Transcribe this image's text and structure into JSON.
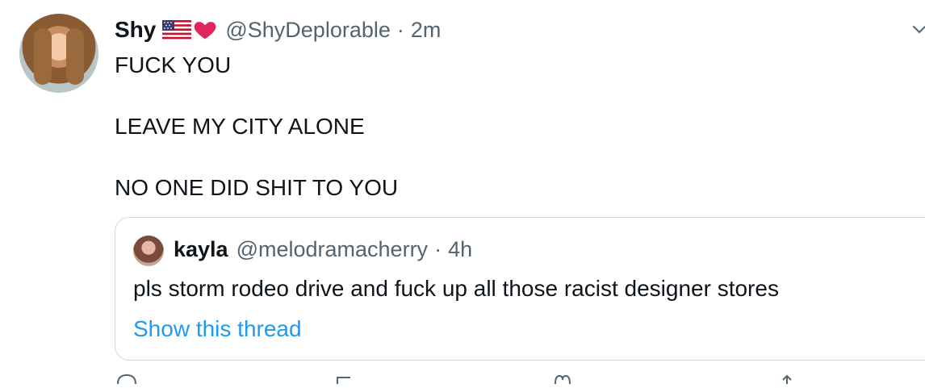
{
  "author": {
    "name": "Shy",
    "handle": "@ShyDeplorable",
    "separator": "·",
    "time": "2m",
    "badges": [
      "us-flag-icon",
      "red-heart-icon"
    ]
  },
  "tweet": {
    "text": "FUCK YOU\n\nLEAVE MY CITY ALONE\n\nNO ONE DID SHIT TO YOU"
  },
  "quoted": {
    "name": "kayla",
    "handle": "@melodramacherry",
    "separator": "·",
    "time": "4h",
    "text": "pls storm rodeo drive and fuck up all those racist designer stores",
    "link_label": "Show this thread"
  },
  "colors": {
    "link": "#1d9bf0",
    "secondary": "#536471",
    "heart": "#e0245e",
    "border": "#cfd9de"
  },
  "actions": [
    "reply-icon",
    "retweet-icon",
    "like-icon",
    "share-icon"
  ]
}
